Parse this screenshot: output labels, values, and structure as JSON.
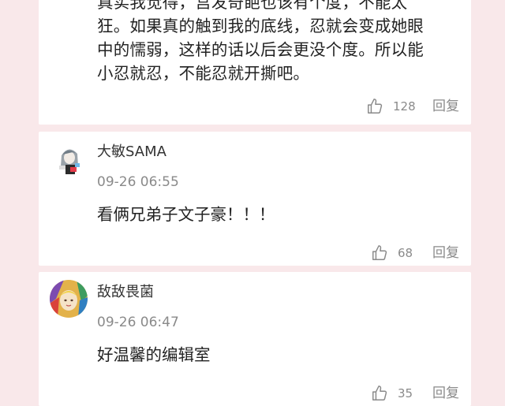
{
  "comments": [
    {
      "text_lines": [
        "真实我觉得，宫发奇葩也该有个度，不能太",
        "狂。如果真的触到我的底线，忍就会变成她眼",
        "中的懦弱，这样的话以后会更没个度。所以能",
        "小忍就忍，不能忍就开撕吧。"
      ],
      "likes": "128",
      "reply_label": "回复"
    },
    {
      "username": "大敏SAMA",
      "timestamp": "09-26 06:55",
      "text": "看俩兄弟子文子豪！！！",
      "likes": "68",
      "reply_label": "回复"
    },
    {
      "username": "敌敌畏菌",
      "timestamp": "09-26 06:47",
      "text": "好温馨的编辑室",
      "likes": "35",
      "reply_label": "回复"
    }
  ],
  "icons": {
    "like": "thumbs-up-icon"
  },
  "colors": {
    "page_background": "#f9e8ea",
    "card_background": "#ffffff",
    "primary_text": "#222222",
    "secondary_text": "#8a8a8a"
  }
}
